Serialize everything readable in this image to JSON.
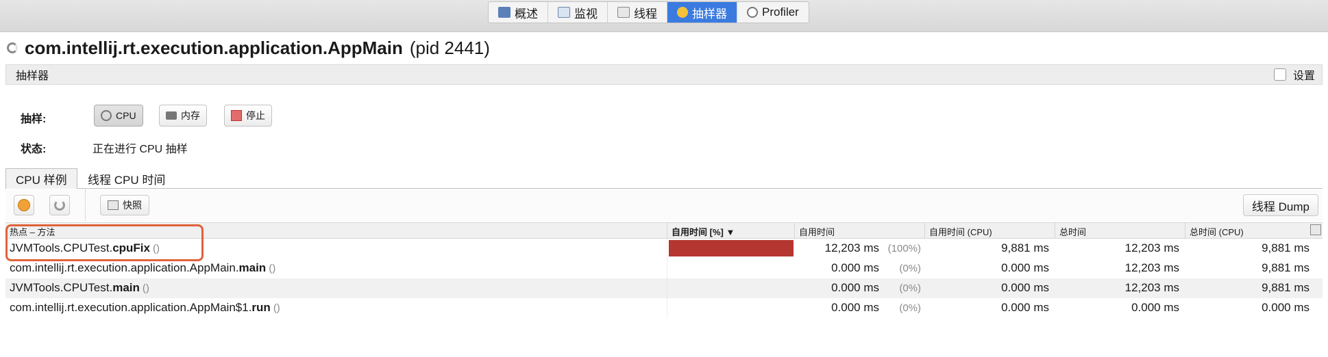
{
  "top_tabs": [
    {
      "label": "概述",
      "icon": "overview-icon"
    },
    {
      "label": "监视",
      "icon": "monitor-icon"
    },
    {
      "label": "线程",
      "icon": "threads-icon"
    },
    {
      "label": "抽样器",
      "icon": "sampler-icon",
      "active": true
    },
    {
      "label": "Profiler",
      "icon": "profiler-icon"
    }
  ],
  "title": {
    "main": "com.intellij.rt.execution.application.AppMain",
    "pid": "(pid 2441)"
  },
  "section": {
    "label": "抽样器",
    "settings_label": "设置"
  },
  "sampling": {
    "label": "抽样:",
    "cpu_button": "CPU",
    "memory_button": "内存",
    "stop_button": "停止"
  },
  "status": {
    "label": "状态:",
    "value": "正在进行 CPU 抽样"
  },
  "sub_tabs": {
    "cpu_samples": "CPU 样例",
    "thread_cpu_time": "线程 CPU 时间"
  },
  "toolbar": {
    "snapshot_label": "快照",
    "thread_dump_label": "线程 Dump"
  },
  "table": {
    "columns": [
      "热点 – 方法",
      "自用时间 [%] ▼",
      "自用时间",
      "自用时间 (CPU)",
      "总时间",
      "总时间 (CPU)"
    ],
    "rows": [
      {
        "class": "JVMTools.CPUTest.",
        "method": "cpuFix",
        "args": "()",
        "self_pct": 100,
        "self_time": "12,203 ms",
        "self_pct_text": "(100%)",
        "self_cpu": "9,881 ms",
        "total": "12,203 ms",
        "total_cpu": "9,881 ms"
      },
      {
        "class": "com.intellij.rt.execution.application.AppMain.",
        "method": "main",
        "args": "()",
        "self_pct": 0,
        "self_time": "0.000 ms",
        "self_pct_text": "(0%)",
        "self_cpu": "0.000 ms",
        "total": "12,203 ms",
        "total_cpu": "9,881 ms"
      },
      {
        "class": "JVMTools.CPUTest.",
        "method": "main",
        "args": "()",
        "self_pct": 0,
        "self_time": "0.000 ms",
        "self_pct_text": "(0%)",
        "self_cpu": "0.000 ms",
        "total": "12,203 ms",
        "total_cpu": "9,881 ms"
      },
      {
        "class": "com.intellij.rt.execution.application.AppMain$1.",
        "method": "run",
        "args": "()",
        "self_pct": 0,
        "self_time": "0.000 ms",
        "self_pct_text": "(0%)",
        "self_cpu": "0.000 ms",
        "total": "0.000 ms",
        "total_cpu": "0.000 ms"
      }
    ]
  },
  "colors": {
    "accent": "#3b7be0",
    "bar": "#b53630",
    "highlight": "#e0623a"
  }
}
